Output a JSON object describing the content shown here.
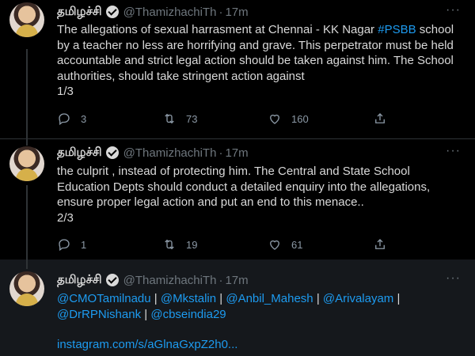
{
  "tweets": [
    {
      "name": "தமிழச்சி",
      "handle": "@ThamizhachiTh",
      "time": "17m",
      "lines": [
        {
          "pre": "The allegations of sexual harrasment at Chennai - KK Nagar ",
          "tag": "#PSBB",
          "post": " school"
        },
        {
          "text": "by a teacher no less are horrifying and grave. This perpetrator must be held"
        },
        {
          "text": "accountable and strict legal action should be taken against him. The School"
        },
        {
          "text": "authorities, should take stringent action against"
        },
        {
          "text": "1/3"
        }
      ],
      "replies": "3",
      "retweets": "73",
      "likes": "160"
    },
    {
      "name": "தமிழச்சி",
      "handle": "@ThamizhachiTh",
      "time": "17m",
      "lines": [
        {
          "text": "the culprit , instead of protecting him. The Central and State School"
        },
        {
          "text": "Education Depts should conduct a detailed enquiry into the allegations,"
        },
        {
          "text": "ensure proper legal action and put an end to this menace.."
        },
        {
          "text": "2/3"
        }
      ],
      "replies": "1",
      "retweets": "19",
      "likes": "61"
    },
    {
      "name": "தமிழச்சி",
      "handle": "@ThamizhachiTh",
      "time": "17m",
      "mentions_line1": [
        "@CMOTamilnadu",
        "@Mkstalin",
        "@Anbil_Mahesh",
        "@Arivalayam"
      ],
      "mentions_line2": [
        "@DrRPNishank",
        "@cbseindia29"
      ],
      "link": "instagram.com/s/aGlnaGxpZ2h0..."
    }
  ],
  "separator": "|",
  "dot": "·",
  "more_label": "···",
  "colors": {
    "background": "#000000",
    "highlight_bg": "#15181c",
    "link": "#1d9bf0",
    "muted": "#6e767d"
  },
  "icons": [
    "verified-badge-icon",
    "reply-icon",
    "retweet-icon",
    "like-icon",
    "share-icon",
    "more-icon"
  ]
}
